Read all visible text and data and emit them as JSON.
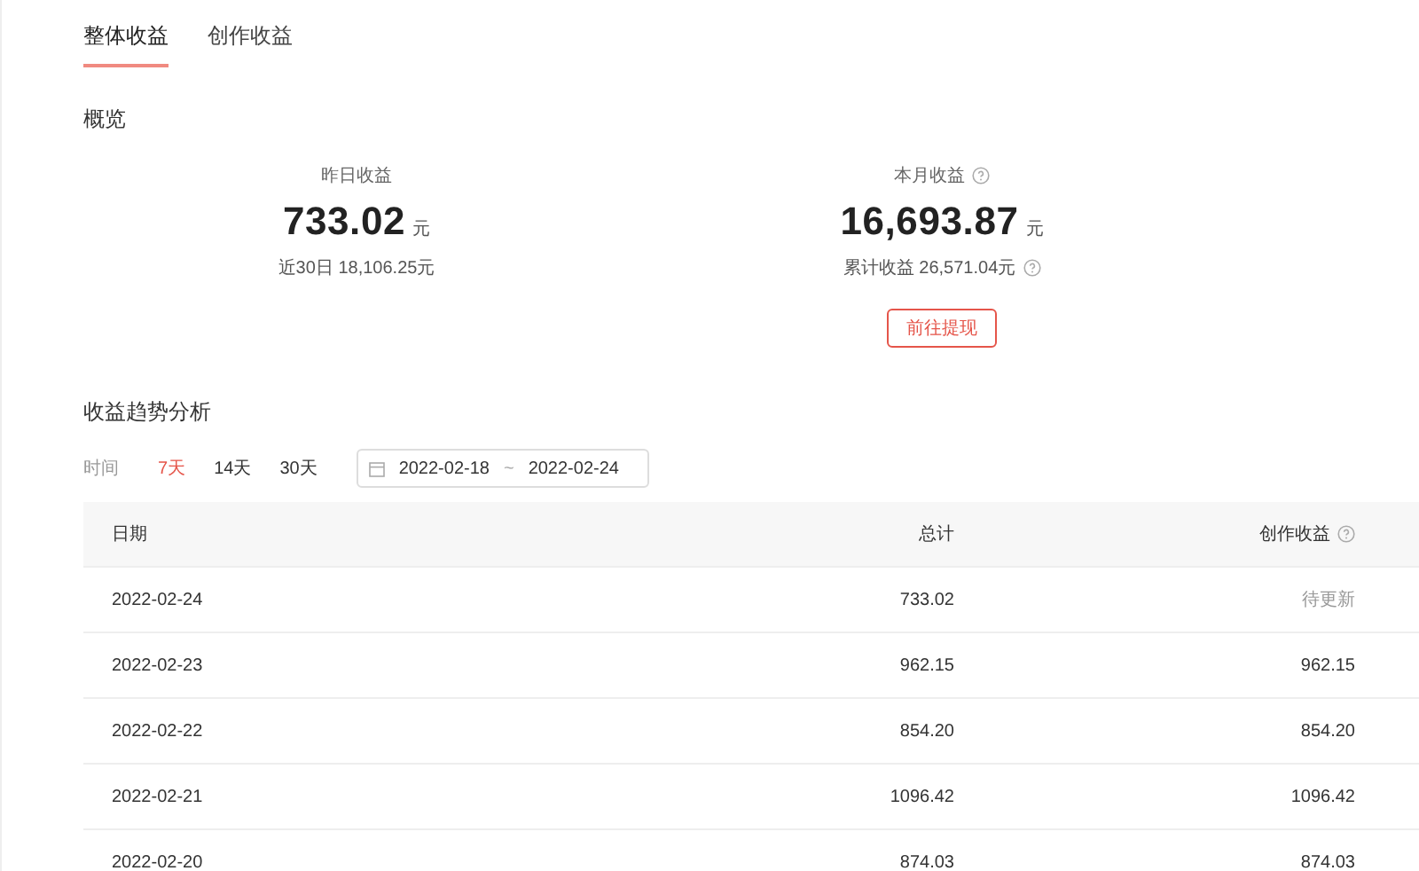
{
  "tabs": [
    {
      "label": "整体收益",
      "selected": true
    },
    {
      "label": "创作收益",
      "selected": false
    }
  ],
  "overview": {
    "title": "概览",
    "stats": [
      {
        "label": "昨日收益",
        "help": false,
        "value": "733.02",
        "unit": "元",
        "sub": "近30日 18,106.25元",
        "sub_help": false
      },
      {
        "label": "本月收益",
        "help": true,
        "value": "16,693.87",
        "unit": "元",
        "sub": "累计收益 26,571.04元",
        "sub_help": true,
        "button": "前往提现"
      }
    ]
  },
  "trend": {
    "title": "收益趋势分析",
    "filter_label": "时间",
    "ranges": [
      {
        "label": "7天",
        "selected": true
      },
      {
        "label": "14天",
        "selected": false
      },
      {
        "label": "30天",
        "selected": false
      }
    ],
    "date_start": "2022-02-18",
    "date_sep": "~",
    "date_end": "2022-02-24"
  },
  "table": {
    "columns": [
      {
        "label": "日期",
        "help": false
      },
      {
        "label": "总计",
        "help": false
      },
      {
        "label": "创作收益",
        "help": true
      }
    ],
    "rows": [
      {
        "date": "2022-02-24",
        "total": "733.02",
        "creative": "待更新",
        "pending": true
      },
      {
        "date": "2022-02-23",
        "total": "962.15",
        "creative": "962.15",
        "pending": false
      },
      {
        "date": "2022-02-22",
        "total": "854.20",
        "creative": "854.20",
        "pending": false
      },
      {
        "date": "2022-02-21",
        "total": "1096.42",
        "creative": "1096.42",
        "pending": false
      },
      {
        "date": "2022-02-20",
        "total": "874.03",
        "creative": "874.03",
        "pending": false
      }
    ]
  }
}
